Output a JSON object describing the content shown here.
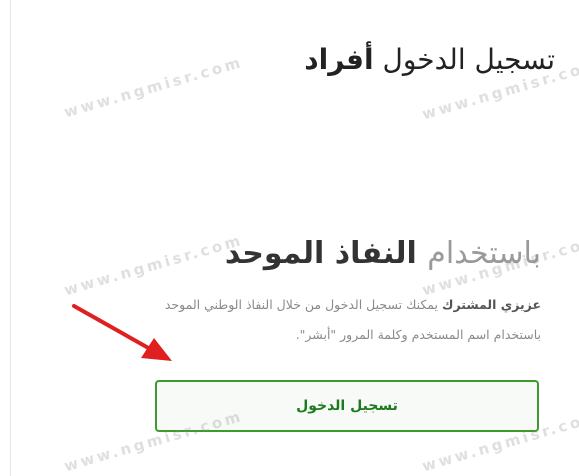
{
  "header": {
    "title_prefix": "تسجيل الدخول",
    "title_emphasis": "أفراد"
  },
  "nafath": {
    "heading_light": "باستخدام",
    "heading_dark": "النفاذ الموحد",
    "description_lead": "عزيزي المشترك",
    "description_text": "يمكنك تسجيل الدخول من خلال النفاذ الوطني الموحد باستخدام اسم المستخدم وكلمة المرور \"أبشر\".",
    "login_button_label": "تسجيل الدخول"
  },
  "watermark": {
    "text": "www.ngmisr.com"
  },
  "colors": {
    "button_border": "#3e9a2c",
    "button_text": "#1d7a1d",
    "arrow": "#e02020"
  }
}
